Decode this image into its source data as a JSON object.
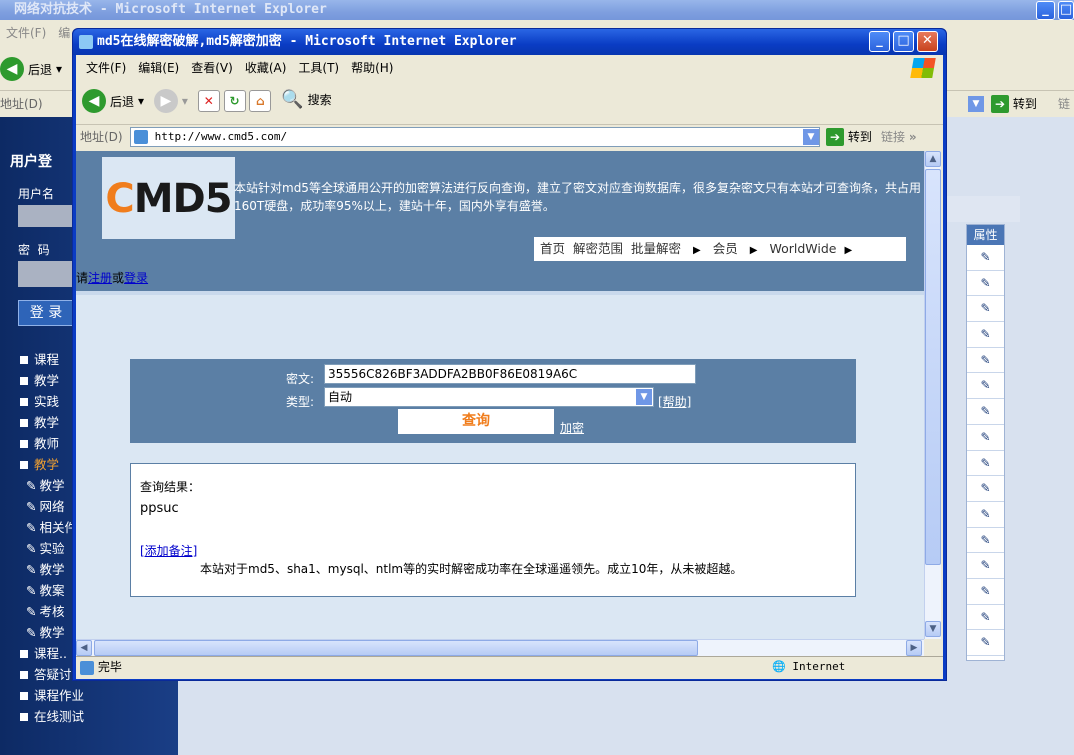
{
  "back": {
    "title": "网络对抗技术 - Microsoft Internet Explorer",
    "menu": [
      "文件(F)",
      "编"
    ],
    "back_btn": "后退",
    "addr_label": "地址(D)",
    "goto": "转到",
    "links": "链",
    "props_header": "属性",
    "props_rows": 16,
    "login": {
      "title": "用户登",
      "username_label": "用户名",
      "password_label": "密  码",
      "login_btn": "登 录"
    },
    "side_items": [
      {
        "label": "课程",
        "kind": "square"
      },
      {
        "label": "教学",
        "kind": "square"
      },
      {
        "label": "实践",
        "kind": "square"
      },
      {
        "label": "教学",
        "kind": "square"
      },
      {
        "label": "教师",
        "kind": "square"
      },
      {
        "label": "教学",
        "kind": "square-active"
      },
      {
        "label": "教学",
        "kind": "pencil"
      },
      {
        "label": "网络",
        "kind": "pencil"
      },
      {
        "label": "相关件",
        "kind": "pencil"
      },
      {
        "label": "实验",
        "kind": "pencil"
      },
      {
        "label": "教学",
        "kind": "pencil"
      },
      {
        "label": "教案",
        "kind": "pencil"
      },
      {
        "label": "考核",
        "kind": "pencil"
      },
      {
        "label": "教学",
        "kind": "pencil"
      },
      {
        "label": "课程..",
        "kind": "square"
      },
      {
        "label": "答疑讨论",
        "kind": "square"
      },
      {
        "label": "课程作业",
        "kind": "square"
      },
      {
        "label": "在线测试",
        "kind": "square"
      }
    ]
  },
  "front": {
    "title": "md5在线解密破解,md5解密加密 - Microsoft Internet Explorer",
    "menu": [
      "文件(F)",
      "编辑(E)",
      "查看(V)",
      "收藏(A)",
      "工具(T)",
      "帮助(H)"
    ],
    "back_btn": "后退",
    "search_btn": "搜索",
    "addr_label": "地址(D)",
    "url": "http://www.cmd5.com/",
    "goto": "转到",
    "links": "链接",
    "status": "完毕",
    "zone": "Internet",
    "page": {
      "logo": "CMD5",
      "intro": "本站针对md5等全球通用公开的加密算法进行反向查询，建立了密文对应查询数据库，很多复杂密文只有本站才可查询条，共占用160T硬盘，成功率95%以上，建站十年，国内外享有盛誉。",
      "nav": [
        "首页",
        "解密范围",
        "批量解密",
        "会员",
        "WorldWide"
      ],
      "register_prefix": "请",
      "register": "注册",
      "or": "或",
      "login": "登录",
      "cipher_label": "密文:",
      "cipher_value": "35556C826BF3ADDFA2BB0F86E0819A6C",
      "type_label": "类型:",
      "type_value": "自动",
      "help_link": "[帮助]",
      "query_btn": "查询",
      "encrypt_link": "加密",
      "result_label": "查询结果：",
      "result_value": "ppsuc",
      "add_note": "[添加备注]",
      "footer_note": "本站对于md5、sha1、mysql、ntlm等的实时解密成功率在全球遥遥领先。成立10年，从未被超越。"
    }
  },
  "colors": {
    "xp_blue": "#0a3cc4",
    "page_bg": "#dbe7f3",
    "cmd_header": "#5b7fa5",
    "logo_orange": "#f07d1c",
    "query_orange": "#f07d1c"
  }
}
